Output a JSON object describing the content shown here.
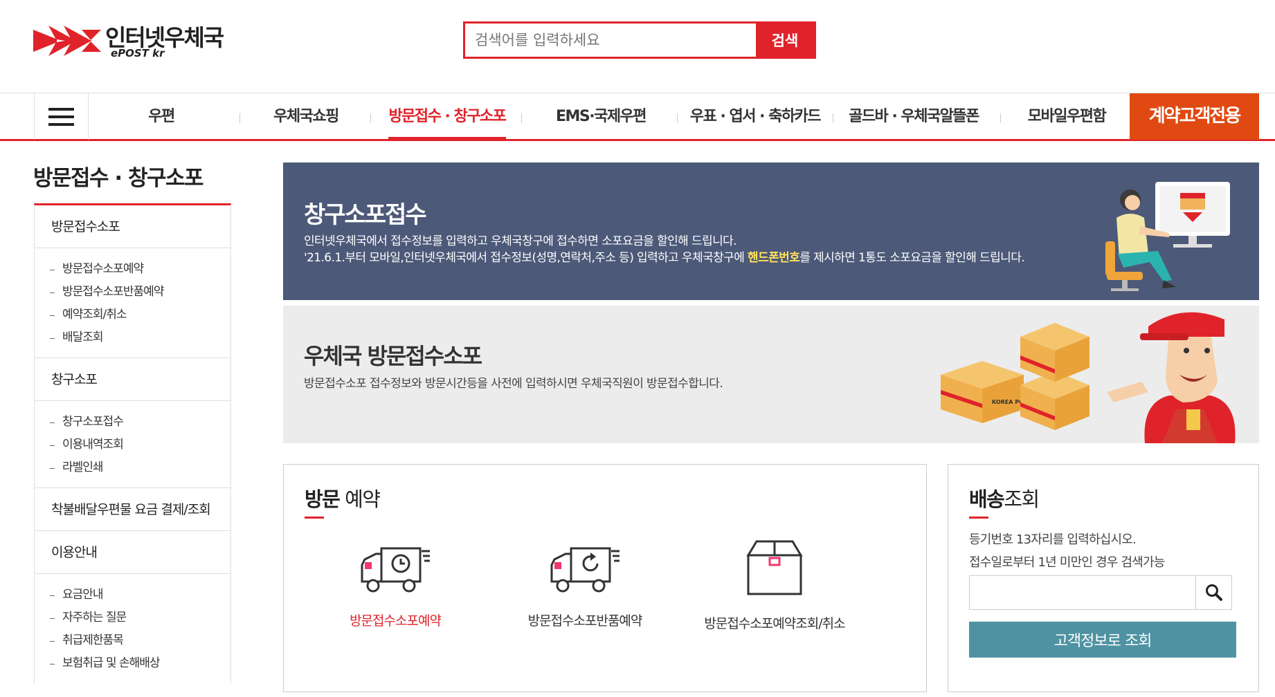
{
  "header": {
    "logo_text": "인터넷우체국",
    "logo_sub": "ePOST kr",
    "search_placeholder": "검색어를 입력하세요",
    "search_button": "검색"
  },
  "nav": {
    "items": [
      "우편",
      "우체국쇼핑",
      "방문접수 · 창구소포",
      "EMS·국제우편",
      "우표 · 엽서 · 축하카드",
      "골드바 · 우체국알뜰폰",
      "모바일우편함"
    ],
    "active_index": 2,
    "cta": "계약고객전용"
  },
  "sidebar": {
    "title": "방문접수 · 창구소포",
    "groups": [
      {
        "label": "방문접수소포",
        "items": [
          "방문접수소포예약",
          "방문접수소포반품예약",
          "예약조회/취소",
          "배달조회"
        ]
      },
      {
        "label": "창구소포",
        "items": [
          "창구소포접수",
          "이용내역조회",
          "라벨인쇄"
        ]
      },
      {
        "label": "착불배달우편물 요금 결제/조회",
        "items": []
      },
      {
        "label": "이용안내",
        "items": [
          "요금안내",
          "자주하는 질문",
          "취급제한품목",
          "보험취급 및 손해배상"
        ]
      }
    ]
  },
  "banner_counter": {
    "title": "창구소포접수",
    "desc1": "인터넷우체국에서 접수정보를 입력하고 우체국창구에 접수하면 소포요금을 할인해 드립니다.",
    "desc2_pre": "'21.6.1.부터 모바일,인터넷우체국에서 접수정보(성명,연락처,주소 등) 입력하고 우체국창구에 ",
    "desc2_highlight": "핸드폰번호",
    "desc2_post": "를 제시하면 1통도 소포요금을 할인해 드립니다."
  },
  "banner_visit": {
    "title": "우체국 방문접수소포",
    "desc": "방문접수소포 접수정보와 방문시간등을 사전에 입력하시면 우체국직원이 방문접수합니다.",
    "box_label": "KOREA POST"
  },
  "visit_box": {
    "title_bold": "방문",
    "title_rest": " 예약",
    "services": [
      {
        "label": "방문접수소포예약",
        "icon": "truck-clock-icon"
      },
      {
        "label": "방문접수소포반품예약",
        "icon": "truck-return-icon"
      },
      {
        "label": "방문접수소포예약조회/취소",
        "icon": "box-icon"
      }
    ]
  },
  "track_box": {
    "title_bold": "배송",
    "title_rest": "조회",
    "desc1": "등기번호 13자리를 입력하십시오.",
    "desc2": "접수일로부터 1년 미만인 경우 검색가능",
    "submit": "고객정보로 조회"
  },
  "colors": {
    "brand_red": "#e0232a",
    "cta_orange": "#e04a12",
    "banner_navy": "#4d5978",
    "highlight_yellow": "#ffe35c",
    "teal_button": "#4f93a3"
  }
}
